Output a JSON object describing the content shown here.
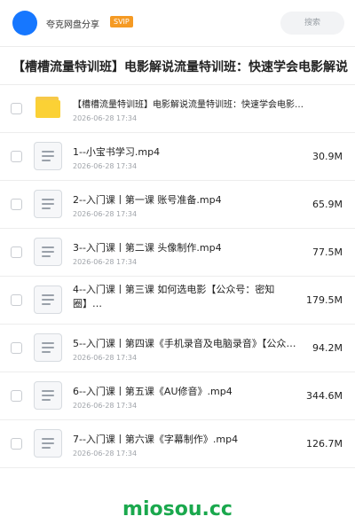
{
  "header": {
    "owner_name": "夸克网盘分享",
    "badge": "SVIP",
    "search_label": "搜索"
  },
  "page_title": "【槽槽流量特训班】电影解说流量特训班：快速学会电影解说",
  "files": [
    {
      "type": "folder",
      "name": "【槽槽流量特训班】电影解说流量特训班：快速学会电影…",
      "date": "2026-06-28 17:34",
      "size": ""
    },
    {
      "type": "file",
      "name": "1--小宝书学习.mp4",
      "date": "2026-06-28 17:34",
      "size": "30.9M"
    },
    {
      "type": "file",
      "name": "2--入门课丨第一课 账号准备.mp4",
      "date": "2026-06-28 17:34",
      "size": "65.9M"
    },
    {
      "type": "file",
      "name": "3--入门课丨第二课 头像制作.mp4",
      "date": "2026-06-28 17:34",
      "size": "77.5M"
    },
    {
      "type": "file",
      "name": "4--入门课丨第三课 如何选电影【公众号：密知圈】…",
      "date": "",
      "size": "179.5M"
    },
    {
      "type": "file",
      "name": "5--入门课丨第四课《手机录音及电脑录音》【公众号…",
      "date": "2026-06-28 17:34",
      "size": "94.2M"
    },
    {
      "type": "file",
      "name": "6--入门课丨第五课《AU修音》.mp4",
      "date": "2026-06-28 17:34",
      "size": "344.6M"
    },
    {
      "type": "file",
      "name": "7--入门课丨第六课《字幕制作》.mp4",
      "date": "2026-06-28 17:34",
      "size": "126.7M"
    }
  ],
  "watermark": "miosou.cc",
  "colors": {
    "accent": "#1677ff",
    "svip": "#f59a23",
    "folder": "#fbd135",
    "watermark": "#1aa84d"
  }
}
